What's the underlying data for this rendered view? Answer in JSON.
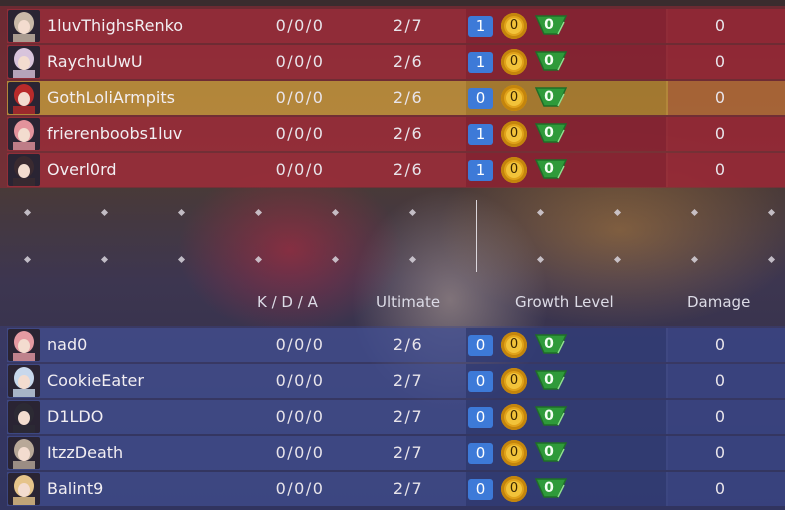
{
  "red_team": [
    {
      "name": "1luvThighsRenko",
      "kda": "0/0/0",
      "ultimate": "2/7",
      "growth_blue": "1",
      "growth_gold": "0",
      "growth_green": "0",
      "damage": "0",
      "highlighted": false,
      "avatar_color": "#c9b9a8"
    },
    {
      "name": "RaychuUwU",
      "kda": "0/0/0",
      "ultimate": "2/6",
      "growth_blue": "1",
      "growth_gold": "0",
      "growth_green": "0",
      "damage": "0",
      "highlighted": false,
      "avatar_color": "#d8c4dc"
    },
    {
      "name": "GothLoliArmpits",
      "kda": "0/0/0",
      "ultimate": "2/6",
      "growth_blue": "0",
      "growth_gold": "0",
      "growth_green": "0",
      "damage": "0",
      "highlighted": true,
      "avatar_color": "#b82a2a"
    },
    {
      "name": "frierenboobs1luv",
      "kda": "0/0/0",
      "ultimate": "2/6",
      "growth_blue": "1",
      "growth_gold": "0",
      "growth_green": "0",
      "damage": "0",
      "highlighted": false,
      "avatar_color": "#e3939c"
    },
    {
      "name": "Overl0rd",
      "kda": "0/0/0",
      "ultimate": "2/6",
      "growth_blue": "1",
      "growth_gold": "0",
      "growth_green": "0",
      "damage": "0",
      "highlighted": false,
      "avatar_color": "#3a2a30"
    }
  ],
  "headers": {
    "kda": "K / D / A",
    "ultimate": "Ultimate",
    "growth": "Growth Level",
    "damage": "Damage"
  },
  "blue_team": [
    {
      "name": "nad0",
      "kda": "0/0/0",
      "ultimate": "2/6",
      "growth_blue": "0",
      "growth_gold": "0",
      "growth_green": "0",
      "damage": "0",
      "avatar_color": "#e59aa2"
    },
    {
      "name": "CookieEater",
      "kda": "0/0/0",
      "ultimate": "2/7",
      "growth_blue": "0",
      "growth_gold": "0",
      "growth_green": "0",
      "damage": "0",
      "avatar_color": "#c8d8ec"
    },
    {
      "name": "D1LDO",
      "kda": "0/0/0",
      "ultimate": "2/7",
      "growth_blue": "0",
      "growth_gold": "0",
      "growth_green": "0",
      "damage": "0",
      "avatar_color": "#2c2a34"
    },
    {
      "name": "ItzzDeath",
      "kda": "0/0/0",
      "ultimate": "2/7",
      "growth_blue": "0",
      "growth_gold": "0",
      "growth_green": "0",
      "damage": "0",
      "avatar_color": "#b8a898"
    },
    {
      "name": "Balint9",
      "kda": "0/0/0",
      "ultimate": "2/7",
      "growth_blue": "0",
      "growth_gold": "0",
      "growth_green": "0",
      "damage": "0",
      "avatar_color": "#e6c48a"
    }
  ],
  "colors": {
    "red_row": "#a02d3a",
    "highlight_row": "#be963c",
    "blue_row": "#445296",
    "growth_blue": "#3d7ad8",
    "growth_gold": "#e0a21a",
    "growth_green": "#2f9a3a"
  }
}
